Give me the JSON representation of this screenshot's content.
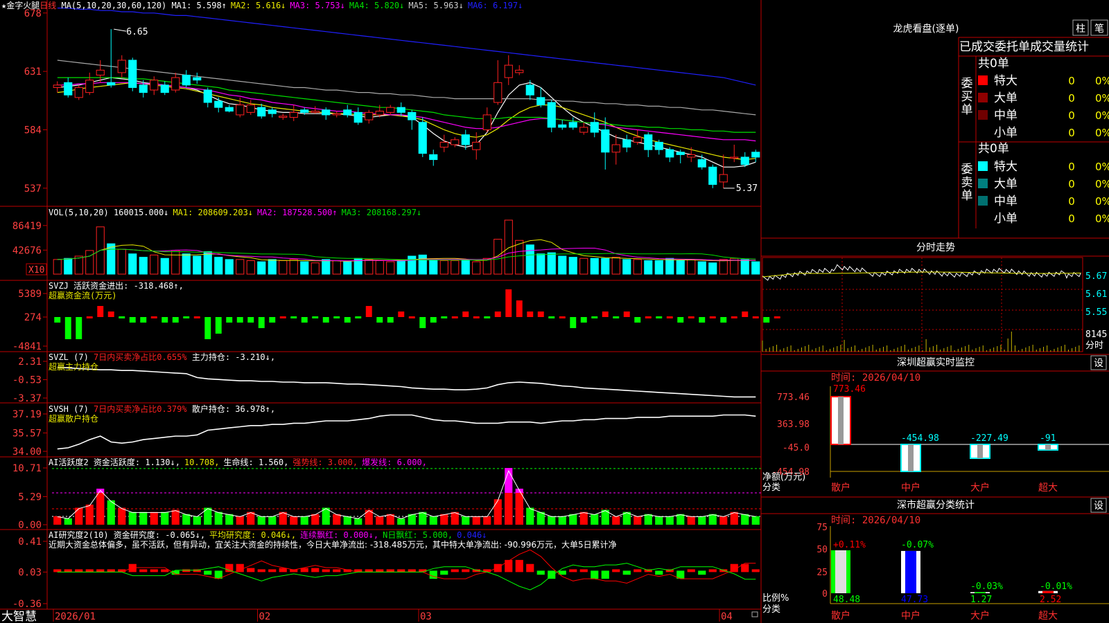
{
  "colors": {
    "up": "#ff2020",
    "down": "#00ffff",
    "ma1": "#ffffff",
    "ma2": "#e8e800",
    "ma3": "#ff00ff",
    "ma4": "#00e000",
    "ma5": "#aaaaaa",
    "ma6": "#2020ff",
    "green": "#00ff00",
    "red": "#ff0000",
    "grid": "#c00000",
    "label": "#ff4040"
  },
  "header": {
    "star_name": "★金字火腿",
    "period": "日线",
    "ma_head": "MA(5,10,20,30,60,120)",
    "ma": [
      {
        "t": "MA1: 5.598↑",
        "c": "#ffffff"
      },
      {
        "t": "MA2: 5.616↓",
        "c": "#e8e800"
      },
      {
        "t": "MA3: 5.753↓",
        "c": "#ff00ff"
      },
      {
        "t": "MA4: 5.820↓",
        "c": "#00e000"
      },
      {
        "t": "MA5: 5.963↓",
        "c": "#cccccc"
      },
      {
        "t": "MA6: 6.197↓",
        "c": "#2020ff"
      }
    ]
  },
  "price_axis": [
    "678",
    "631",
    "584",
    "537"
  ],
  "price_notes": {
    "high": "6.65",
    "low": "5.37"
  },
  "vol": {
    "axis": [
      "86419",
      "42676"
    ],
    "x10": "X10",
    "head": "VOL(5,10,20)",
    "items": [
      {
        "t": "160015.000↓",
        "c": "#ffffff"
      },
      {
        "t": "MA1: 208609.203↓",
        "c": "#e8e800"
      },
      {
        "t": "MA2: 187528.500↑",
        "c": "#ff00ff"
      },
      {
        "t": "MA3: 208168.297↓",
        "c": "#00e000"
      }
    ]
  },
  "svzj": {
    "axis": [
      "5389",
      "274",
      "-4841"
    ],
    "head": "SVZJ  活跃资金进出: -318.468↑,",
    "sub": "超赢资金流(万元)"
  },
  "svzl": {
    "axis": [
      "2.31",
      "-0.53",
      "-3.37"
    ],
    "head_a": "SVZL (7)",
    "head_b": "7日内买卖净占比0.655%",
    "head_c": "主力持仓: -3.210↓,",
    "sub": "超赢主力持仓"
  },
  "svsh": {
    "axis": [
      "37.19",
      "35.57",
      "34.00"
    ],
    "head_a": "SVSH (7)",
    "head_b": "7日内买卖净占比0.379%",
    "head_c": "散户持仓: 36.978↑,",
    "sub": "超赢散户持仓"
  },
  "ai1": {
    "axis": [
      "10.71",
      "5.29",
      "0.00"
    ],
    "items": [
      {
        "t": "AI活跃度2 资金活跃度: 1.130↓,",
        "c": "#ffffff"
      },
      {
        "t": "10.708,",
        "c": "#e8e800"
      },
      {
        "t": "生命线: 1.560,",
        "c": "#ffffff"
      },
      {
        "t": "强势线: 3.000,",
        "c": "#ff2020"
      },
      {
        "t": "爆发线: 6.000,",
        "c": "#ff00ff"
      }
    ]
  },
  "ai2": {
    "axis": [
      "0.41",
      "0.03",
      "-0.36"
    ],
    "items": [
      {
        "t": "AI研究度2(10) 资金研究度: -0.065↓,",
        "c": "#ffffff"
      },
      {
        "t": "平均研究度: 0.046↓,",
        "c": "#e8e800"
      },
      {
        "t": "连续飘红: 0.000↓,",
        "c": "#ff00ff"
      },
      {
        "t": "N日飘红: 5.000,",
        "c": "#00e000"
      },
      {
        "t": "0.046↓",
        "c": "#2020ff"
      }
    ],
    "desc": "近期大资金总体偏多，虽不活跃，但有异动，宜关注大资金的持续性，今日大单净流出: -318.485万元，其中特大单净流出: -90.996万元，大单5日累计净"
  },
  "xaxis": {
    "logo": "大智慧",
    "labels": [
      "2026/01",
      "02",
      "03",
      "04"
    ]
  },
  "right": {
    "lh_title": "龙虎看盘(逐单)",
    "btn_zhu": "柱",
    "btn_bi": "笔",
    "tabs": "已成交委托单成交量统计",
    "buy_label": "委买单",
    "sell_label": "委卖单",
    "buy_total": "共0单",
    "sell_total": "共0单",
    "buy_rows": [
      {
        "name": "特大",
        "n": "0",
        "p": "0%",
        "c": "#ff0000"
      },
      {
        "name": "大单",
        "n": "0",
        "p": "0%",
        "c": "#900000"
      },
      {
        "name": "中单",
        "n": "0",
        "p": "0%",
        "c": "#700000"
      },
      {
        "name": "小单",
        "n": "0",
        "p": "0%",
        "c": ""
      }
    ],
    "sell_rows": [
      {
        "name": "特大",
        "n": "0",
        "p": "0%",
        "c": "#00ffff"
      },
      {
        "name": "大单",
        "n": "0",
        "p": "0%",
        "c": "#008080"
      },
      {
        "name": "中单",
        "n": "0",
        "p": "0%",
        "c": "#007070"
      },
      {
        "name": "小单",
        "n": "0",
        "p": "0%",
        "c": ""
      }
    ],
    "fs_title": "分时走势",
    "fs_axis": [
      "5.67",
      "5.61",
      "5.55"
    ],
    "fs_vol": "8145",
    "fs_unit": "分时",
    "sz_title": "深圳超赢实时监控",
    "settings": "设",
    "sz_time": "时间: 2026/04/10",
    "sz_axis": [
      "773.46",
      "363.98",
      "-45.0",
      "-454.98"
    ],
    "sz_ylabel": "净额(万元)",
    "sz_xlabel": "分类",
    "cats": [
      "散户",
      "中户",
      "大户",
      "超大"
    ],
    "sz_values": [
      "773.46",
      "-454.98",
      "-227.49",
      "-91"
    ],
    "fl_title": "深市超赢分类统计",
    "fl_time": "时间: 2026/04/10",
    "fl_axis": [
      "75",
      "50",
      "25",
      "0"
    ],
    "fl_ylabel": "比例%",
    "fl_xlabel": "分类",
    "fl_top": [
      "+0.11%",
      "-0.07%",
      "-0.03%",
      "-0.01%"
    ],
    "fl_bottom": [
      "48.48",
      "47.73",
      "1.27",
      "2.52"
    ]
  },
  "chart_data": {
    "type": "candlestick",
    "y_range": [
      5.28,
      6.84
    ],
    "candles": [
      [
        6.18,
        6.2,
        6.23,
        6.14
      ],
      [
        6.22,
        6.12,
        6.26,
        6.1
      ],
      [
        6.1,
        6.18,
        6.2,
        6.08
      ],
      [
        6.14,
        6.24,
        6.3,
        6.12
      ],
      [
        6.28,
        6.32,
        6.4,
        6.22
      ],
      [
        6.22,
        6.2,
        6.65,
        6.18
      ],
      [
        6.3,
        6.4,
        6.44,
        6.26
      ],
      [
        6.4,
        6.18,
        6.42,
        6.15
      ],
      [
        6.2,
        6.14,
        6.24,
        6.1
      ],
      [
        6.16,
        6.24,
        6.27,
        6.12
      ],
      [
        6.2,
        6.14,
        6.23,
        6.12
      ],
      [
        6.16,
        6.26,
        6.3,
        6.14
      ],
      [
        6.28,
        6.2,
        6.32,
        6.18
      ],
      [
        6.26,
        6.24,
        6.3,
        6.21
      ],
      [
        6.16,
        6.06,
        6.18,
        6.02
      ],
      [
        6.07,
        6.02,
        6.1,
        5.98
      ],
      [
        6.02,
        5.99,
        6.04,
        5.98
      ],
      [
        5.96,
        6.04,
        6.1,
        5.94
      ],
      [
        5.98,
        6.04,
        6.08,
        5.96
      ],
      [
        6.02,
        5.95,
        6.05,
        5.93
      ],
      [
        6.0,
        5.97,
        6.02,
        5.94
      ],
      [
        5.94,
        5.95,
        5.97,
        5.92
      ],
      [
        5.94,
        5.98,
        6.04,
        5.91
      ],
      [
        6.0,
        5.98,
        6.02,
        5.96
      ],
      [
        5.98,
        5.99,
        6.03,
        5.97
      ],
      [
        6.0,
        5.96,
        6.02,
        5.92
      ],
      [
        5.96,
        5.97,
        5.99,
        5.94
      ],
      [
        6.0,
        5.96,
        6.04,
        5.94
      ],
      [
        5.98,
        5.9,
        6.02,
        5.88
      ],
      [
        5.92,
        5.98,
        6.0,
        5.89
      ],
      [
        5.96,
        5.99,
        6.04,
        5.94
      ],
      [
        5.98,
        6.02,
        6.04,
        5.96
      ],
      [
        6.02,
        5.98,
        6.06,
        5.95
      ],
      [
        5.98,
        5.92,
        6.0,
        5.84
      ],
      [
        5.9,
        5.65,
        5.94,
        5.62
      ],
      [
        5.64,
        5.6,
        5.68,
        5.55
      ],
      [
        5.7,
        5.74,
        5.8,
        5.66
      ],
      [
        5.72,
        5.76,
        5.78,
        5.7
      ],
      [
        5.8,
        5.72,
        5.84,
        5.68
      ],
      [
        5.68,
        5.74,
        5.82,
        5.6
      ],
      [
        5.84,
        5.96,
        6.02,
        5.82
      ],
      [
        6.06,
        6.22,
        6.4,
        6.04
      ],
      [
        6.26,
        6.36,
        6.44,
        6.2
      ],
      [
        6.3,
        6.32,
        6.36,
        6.28
      ],
      [
        6.2,
        6.12,
        6.24,
        6.08
      ],
      [
        6.1,
        6.04,
        6.18,
        6.02
      ],
      [
        6.06,
        5.86,
        6.08,
        5.82
      ],
      [
        5.88,
        5.86,
        5.92,
        5.84
      ],
      [
        5.9,
        5.86,
        5.94,
        5.84
      ],
      [
        5.82,
        5.86,
        5.9,
        5.8
      ],
      [
        5.9,
        5.82,
        5.98,
        5.78
      ],
      [
        5.84,
        5.66,
        5.94,
        5.52
      ],
      [
        5.66,
        5.72,
        5.8,
        5.56
      ],
      [
        5.76,
        5.7,
        5.8,
        5.66
      ],
      [
        5.74,
        5.78,
        5.84,
        5.72
      ],
      [
        5.8,
        5.68,
        5.82,
        5.62
      ],
      [
        5.74,
        5.68,
        5.76,
        5.64
      ],
      [
        5.68,
        5.62,
        5.7,
        5.58
      ],
      [
        5.66,
        5.64,
        5.68,
        5.57
      ],
      [
        5.62,
        5.64,
        5.7,
        5.58
      ],
      [
        5.6,
        5.54,
        5.64,
        5.52
      ],
      [
        5.54,
        5.4,
        5.56,
        5.37
      ],
      [
        5.42,
        5.48,
        5.64,
        5.37
      ],
      [
        5.62,
        5.62,
        5.72,
        5.58
      ],
      [
        5.62,
        5.56,
        5.66,
        5.54
      ],
      [
        5.66,
        5.62,
        5.68,
        5.58
      ]
    ],
    "ma_lines": {
      "ma1": [
        6.18,
        6.19,
        6.2,
        6.22,
        6.24,
        6.26,
        6.25,
        6.24,
        6.22,
        6.21,
        6.2,
        6.19,
        6.18,
        6.16,
        6.12,
        6.08,
        6.05,
        6.04,
        6.02,
        6.0,
        5.99,
        5.98,
        5.98,
        5.97,
        5.97,
        5.97,
        5.97,
        5.96,
        5.95,
        5.94,
        5.95,
        5.96,
        5.96,
        5.94,
        5.88,
        5.81,
        5.75,
        5.72,
        5.7,
        5.72,
        5.82,
        5.98,
        6.12,
        6.2,
        6.22,
        6.18,
        6.1,
        6.02,
        5.95,
        5.9,
        5.86,
        5.82,
        5.78,
        5.76,
        5.74,
        5.72,
        5.7,
        5.68,
        5.66,
        5.64,
        5.62,
        5.58,
        5.54,
        5.54,
        5.55,
        5.58
      ],
      "ma2": [
        6.14,
        6.15,
        6.17,
        6.18,
        6.19,
        6.2,
        6.21,
        6.22,
        6.21,
        6.2,
        6.19,
        6.18,
        6.17,
        6.15,
        6.13,
        6.11,
        6.09,
        6.07,
        6.05,
        6.04,
        6.02,
        6.01,
        6.0,
        5.99,
        5.98,
        5.98,
        5.97,
        5.97,
        5.96,
        5.96,
        5.96,
        5.96,
        5.95,
        5.94,
        5.92,
        5.88,
        5.84,
        5.81,
        5.79,
        5.78,
        5.8,
        5.85,
        5.92,
        5.98,
        6.02,
        6.04,
        6.04,
        6.02,
        5.99,
        5.96,
        5.93,
        5.9,
        5.86,
        5.82,
        5.79,
        5.76,
        5.74,
        5.72,
        5.7,
        5.68,
        5.66,
        5.64,
        5.62,
        5.61,
        5.6,
        5.61
      ],
      "ma3": [
        6.2,
        6.2,
        6.21,
        6.21,
        6.22,
        6.22,
        6.22,
        6.22,
        6.21,
        6.21,
        6.2,
        6.19,
        6.18,
        6.17,
        6.16,
        6.14,
        6.12,
        6.11,
        6.09,
        6.08,
        6.06,
        6.05,
        6.04,
        6.02,
        6.01,
        6.0,
        5.99,
        5.99,
        5.98,
        5.97,
        5.97,
        5.96,
        5.96,
        5.95,
        5.94,
        5.92,
        5.9,
        5.88,
        5.86,
        5.85,
        5.85,
        5.86,
        5.88,
        5.9,
        5.92,
        5.93,
        5.93,
        5.92,
        5.91,
        5.9,
        5.89,
        5.88,
        5.86,
        5.85,
        5.84,
        5.83,
        5.82,
        5.81,
        5.8,
        5.79,
        5.78,
        5.77,
        5.76,
        5.76,
        5.76,
        5.75
      ],
      "ma4": [
        6.26,
        6.26,
        6.26,
        6.26,
        6.26,
        6.26,
        6.26,
        6.25,
        6.25,
        6.24,
        6.23,
        6.22,
        6.21,
        6.2,
        6.19,
        6.18,
        6.16,
        6.15,
        6.14,
        6.13,
        6.12,
        6.11,
        6.1,
        6.09,
        6.08,
        6.07,
        6.06,
        6.05,
        6.04,
        6.03,
        6.02,
        6.02,
        6.01,
        6.0,
        5.99,
        5.98,
        5.96,
        5.95,
        5.94,
        5.93,
        5.93,
        5.93,
        5.94,
        5.94,
        5.94,
        5.94,
        5.93,
        5.92,
        5.91,
        5.9,
        5.89,
        5.89,
        5.88,
        5.87,
        5.87,
        5.86,
        5.86,
        5.85,
        5.85,
        5.84,
        5.84,
        5.83,
        5.83,
        5.82,
        5.82,
        5.82
      ],
      "ma5": [
        6.4,
        6.39,
        6.38,
        6.37,
        6.36,
        6.35,
        6.34,
        6.33,
        6.32,
        6.31,
        6.3,
        6.29,
        6.28,
        6.27,
        6.26,
        6.25,
        6.24,
        6.23,
        6.22,
        6.21,
        6.2,
        6.19,
        6.18,
        6.18,
        6.17,
        6.16,
        6.16,
        6.15,
        6.14,
        6.14,
        6.13,
        6.13,
        6.12,
        6.12,
        6.11,
        6.1,
        6.1,
        6.09,
        6.09,
        6.09,
        6.09,
        6.09,
        6.09,
        6.09,
        6.09,
        6.08,
        6.08,
        6.07,
        6.07,
        6.06,
        6.06,
        6.05,
        6.05,
        6.04,
        6.04,
        6.03,
        6.03,
        6.02,
        6.02,
        6.01,
        6.0,
        6.0,
        5.99,
        5.98,
        5.97,
        5.96
      ],
      "ma6": [
        6.82,
        6.82,
        6.81,
        6.81,
        6.8,
        6.8,
        6.79,
        6.79,
        6.78,
        6.78,
        6.77,
        6.76,
        6.76,
        6.75,
        6.74,
        6.73,
        6.72,
        6.71,
        6.7,
        6.69,
        6.68,
        6.67,
        6.66,
        6.65,
        6.64,
        6.63,
        6.62,
        6.61,
        6.6,
        6.59,
        6.58,
        6.57,
        6.56,
        6.55,
        6.54,
        6.53,
        6.52,
        6.51,
        6.5,
        6.49,
        6.48,
        6.47,
        6.46,
        6.45,
        6.44,
        6.43,
        6.42,
        6.41,
        6.4,
        6.39,
        6.38,
        6.37,
        6.36,
        6.35,
        6.34,
        6.33,
        6.32,
        6.31,
        6.3,
        6.29,
        6.28,
        6.27,
        6.26,
        6.24,
        6.22,
        6.2
      ]
    },
    "volume": [
      2.6,
      2.8,
      3.2,
      4.2,
      8.4,
      5.4,
      4.4,
      3.6,
      3.0,
      3.4,
      2.8,
      4.2,
      3.6,
      3.2,
      4.0,
      3.0,
      2.6,
      2.6,
      2.4,
      2.2,
      2.6,
      2.4,
      2.6,
      2.2,
      2.0,
      2.6,
      2.4,
      2.2,
      2.8,
      2.6,
      2.4,
      2.2,
      2.4,
      3.2,
      3.4,
      2.6,
      2.4,
      2.4,
      2.6,
      2.2,
      2.8,
      6.2,
      9.6,
      6.0,
      5.2,
      3.6,
      3.8,
      3.2,
      3.0,
      2.8,
      2.8,
      2.8,
      3.0,
      2.6,
      2.6,
      2.4,
      2.4,
      2.8,
      2.4,
      2.6,
      2.2,
      2.0,
      2.6,
      2.8,
      2.6,
      2.2
    ],
    "svzj": [
      -1,
      -4,
      -4,
      0,
      2,
      1,
      0,
      -1,
      -1,
      0,
      -1,
      -1,
      0,
      0,
      -4,
      -3,
      -1,
      -1,
      -1,
      -2,
      -1,
      0,
      0,
      -1,
      0,
      -1,
      0,
      -1,
      0,
      2,
      -1,
      -1,
      1,
      0,
      -2,
      -1,
      0,
      0,
      1,
      0,
      0,
      1,
      5,
      3,
      1,
      1,
      0,
      0,
      -2,
      -1,
      0,
      1,
      0,
      1,
      -1,
      0,
      0,
      0,
      -1,
      0,
      -1,
      0,
      -1,
      0,
      1,
      0,
      -1,
      0
    ],
    "svzl": [
      1.4,
      1.3,
      1.2,
      1.1,
      1.0,
      1.0,
      0.9,
      0.9,
      0.8,
      0.7,
      0.6,
      0.5,
      0.4,
      -0.2,
      -0.4,
      -0.5,
      -0.6,
      -0.7,
      -0.7,
      -0.8,
      -0.8,
      -0.9,
      -0.9,
      -1.0,
      -1.0,
      -1.0,
      -1.1,
      -1.2,
      -1.2,
      -1.3,
      -1.4,
      -1.5,
      -1.6,
      -1.8,
      -1.9,
      -2.0,
      -2.0,
      -2.1,
      -2.1,
      -2.0,
      -1.8,
      -1.3,
      -1.0,
      -0.9,
      -1.0,
      -1.1,
      -1.3,
      -1.5,
      -1.6,
      -1.8,
      -1.9,
      -2.0,
      -2.1,
      -2.2,
      -2.3,
      -2.4,
      -2.5,
      -2.6,
      -2.7,
      -2.8,
      -2.9,
      -3.0,
      -3.1,
      -3.2,
      -3.2,
      -3.2
    ],
    "svsh": [
      34.2,
      34.3,
      34.6,
      35.0,
      35.3,
      34.8,
      34.7,
      34.8,
      35.0,
      35.1,
      35.2,
      35.3,
      35.3,
      35.4,
      35.8,
      35.9,
      36.0,
      36.1,
      36.2,
      36.2,
      36.3,
      36.3,
      36.4,
      36.4,
      36.5,
      36.6,
      36.6,
      36.6,
      36.7,
      36.8,
      37.0,
      37.1,
      37.1,
      37.1,
      36.9,
      36.7,
      36.6,
      36.6,
      36.5,
      36.4,
      36.4,
      36.4,
      36.5,
      36.5,
      36.5,
      36.4,
      36.5,
      36.6,
      36.6,
      36.7,
      36.7,
      36.8,
      36.8,
      36.8,
      36.9,
      36.9,
      36.9,
      37.0,
      37.0,
      37.0,
      37.0,
      37.0,
      37.1,
      37.1,
      37.1,
      37.0
    ],
    "ai1": [
      1.6,
      1.2,
      3.2,
      3.8,
      6.8,
      4.6,
      3.2,
      2.4,
      2.4,
      2.4,
      2.4,
      2.8,
      2.0,
      1.6,
      3.2,
      2.4,
      2.0,
      1.6,
      2.4,
      1.6,
      1.6,
      2.4,
      1.6,
      1.6,
      2.0,
      3.2,
      2.0,
      1.6,
      1.2,
      2.8,
      1.6,
      2.0,
      1.2,
      2.0,
      2.4,
      1.6,
      2.0,
      2.4,
      1.6,
      1.6,
      1.6,
      4.8,
      10.7,
      6.8,
      3.2,
      2.4,
      1.6,
      1.6,
      2.0,
      2.4,
      2.0,
      2.8,
      1.6,
      2.4,
      1.6,
      2.0,
      1.6,
      1.6,
      2.0,
      1.6,
      1.6,
      2.0,
      1.6,
      2.4,
      2.0,
      1.6
    ],
    "ai2": [
      0.0,
      0.0,
      0.0,
      0.0,
      0.0,
      0.0,
      0.0,
      0.1,
      0.0,
      0.0,
      0.0,
      -0.05,
      0.0,
      0.0,
      -0.05,
      -0.1,
      0.1,
      0.1,
      0.05,
      0.0,
      0.0,
      0.05,
      0.0,
      0.05,
      0.05,
      0.0,
      0.0,
      0.0,
      0.0,
      0.0,
      0.0,
      0.0,
      0.0,
      0.0,
      0.0,
      -0.1,
      -0.05,
      0.0,
      0.0,
      0.0,
      0.0,
      0.1,
      0.15,
      0.15,
      0.1,
      -0.05,
      -0.1,
      -0.05,
      0.0,
      0.0,
      -0.1,
      -0.1,
      0.0,
      -0.05,
      0.0,
      0.0,
      -0.05,
      0.0,
      -0.1,
      0.0,
      -0.05,
      0.0,
      0.0,
      0.1,
      0.1,
      0.0
    ]
  }
}
